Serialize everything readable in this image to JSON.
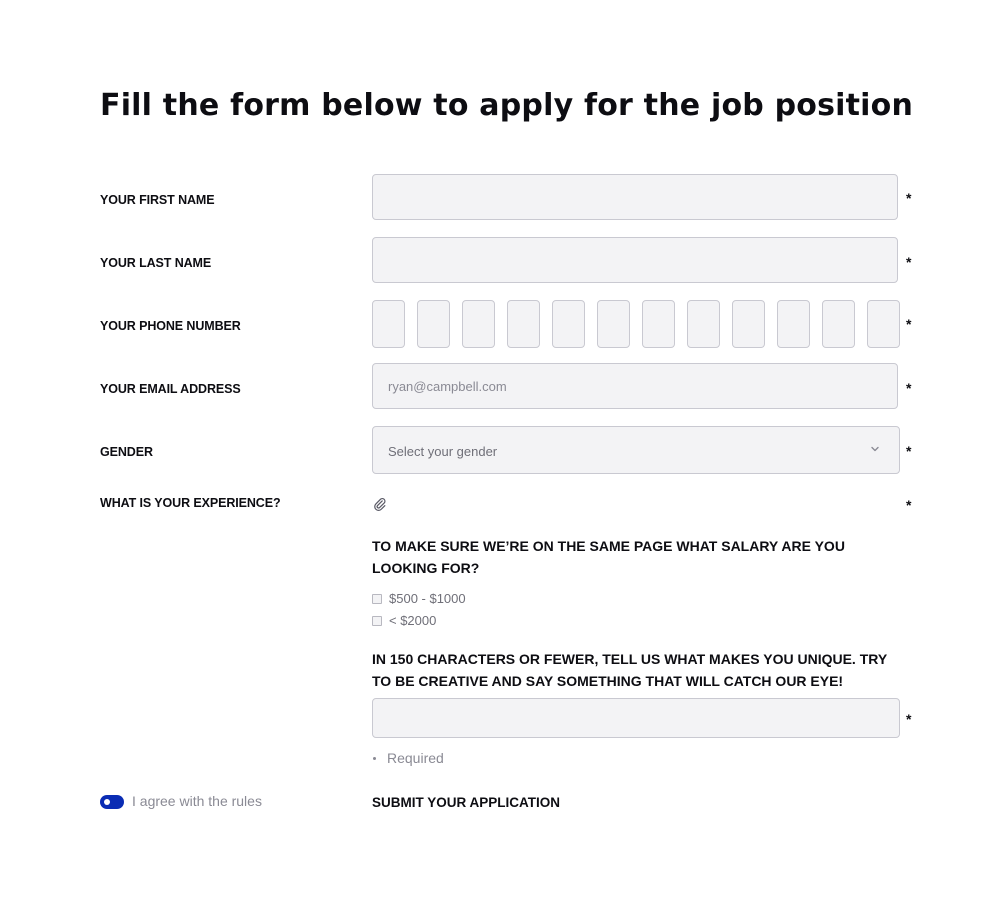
{
  "form": {
    "title": "Fill the form below to apply for the job position",
    "required_marker": "*",
    "first_name": {
      "label": "YOUR FIRST NAME",
      "value": "",
      "placeholder": ""
    },
    "last_name": {
      "label": "YOUR LAST NAME",
      "value": "",
      "placeholder": ""
    },
    "phone": {
      "label": "YOUR PHONE NUMBER",
      "digit_count": 12
    },
    "email": {
      "label": "YOUR EMAIL ADDRESS",
      "value": "",
      "placeholder": "ryan@campbell.com"
    },
    "gender": {
      "label": "GENDER",
      "selected": "Select your gender"
    },
    "experience": {
      "label": "WHAT IS YOUR EXPERIENCE?",
      "icon": "paperclip-icon"
    },
    "salary": {
      "question": "TO MAKE SURE WE’RE ON THE SAME PAGE WHAT SALARY ARE YOU LOOKING FOR?",
      "options": [
        {
          "label": "$500 - $1000",
          "checked": false
        },
        {
          "label": "< $2000",
          "checked": false
        }
      ]
    },
    "unique": {
      "question": "IN 150 CHARACTERS OR FEWER, TELL US WHAT MAKES YOU UNIQUE. TRY TO BE CREATIVE AND SAY SOMETHING THAT WILL CATCH OUR EYE!",
      "value": "",
      "required_note": "Required"
    },
    "agree": {
      "label": "I agree with the rules",
      "on": true
    },
    "submit_label": "SUBMIT YOUR APPLICATION"
  },
  "colors": {
    "accent": "#0a2cb4",
    "field_bg": "#f3f3f5",
    "field_border": "#c9c9d1",
    "text": "#0d0d12",
    "muted": "#8a8a94"
  }
}
